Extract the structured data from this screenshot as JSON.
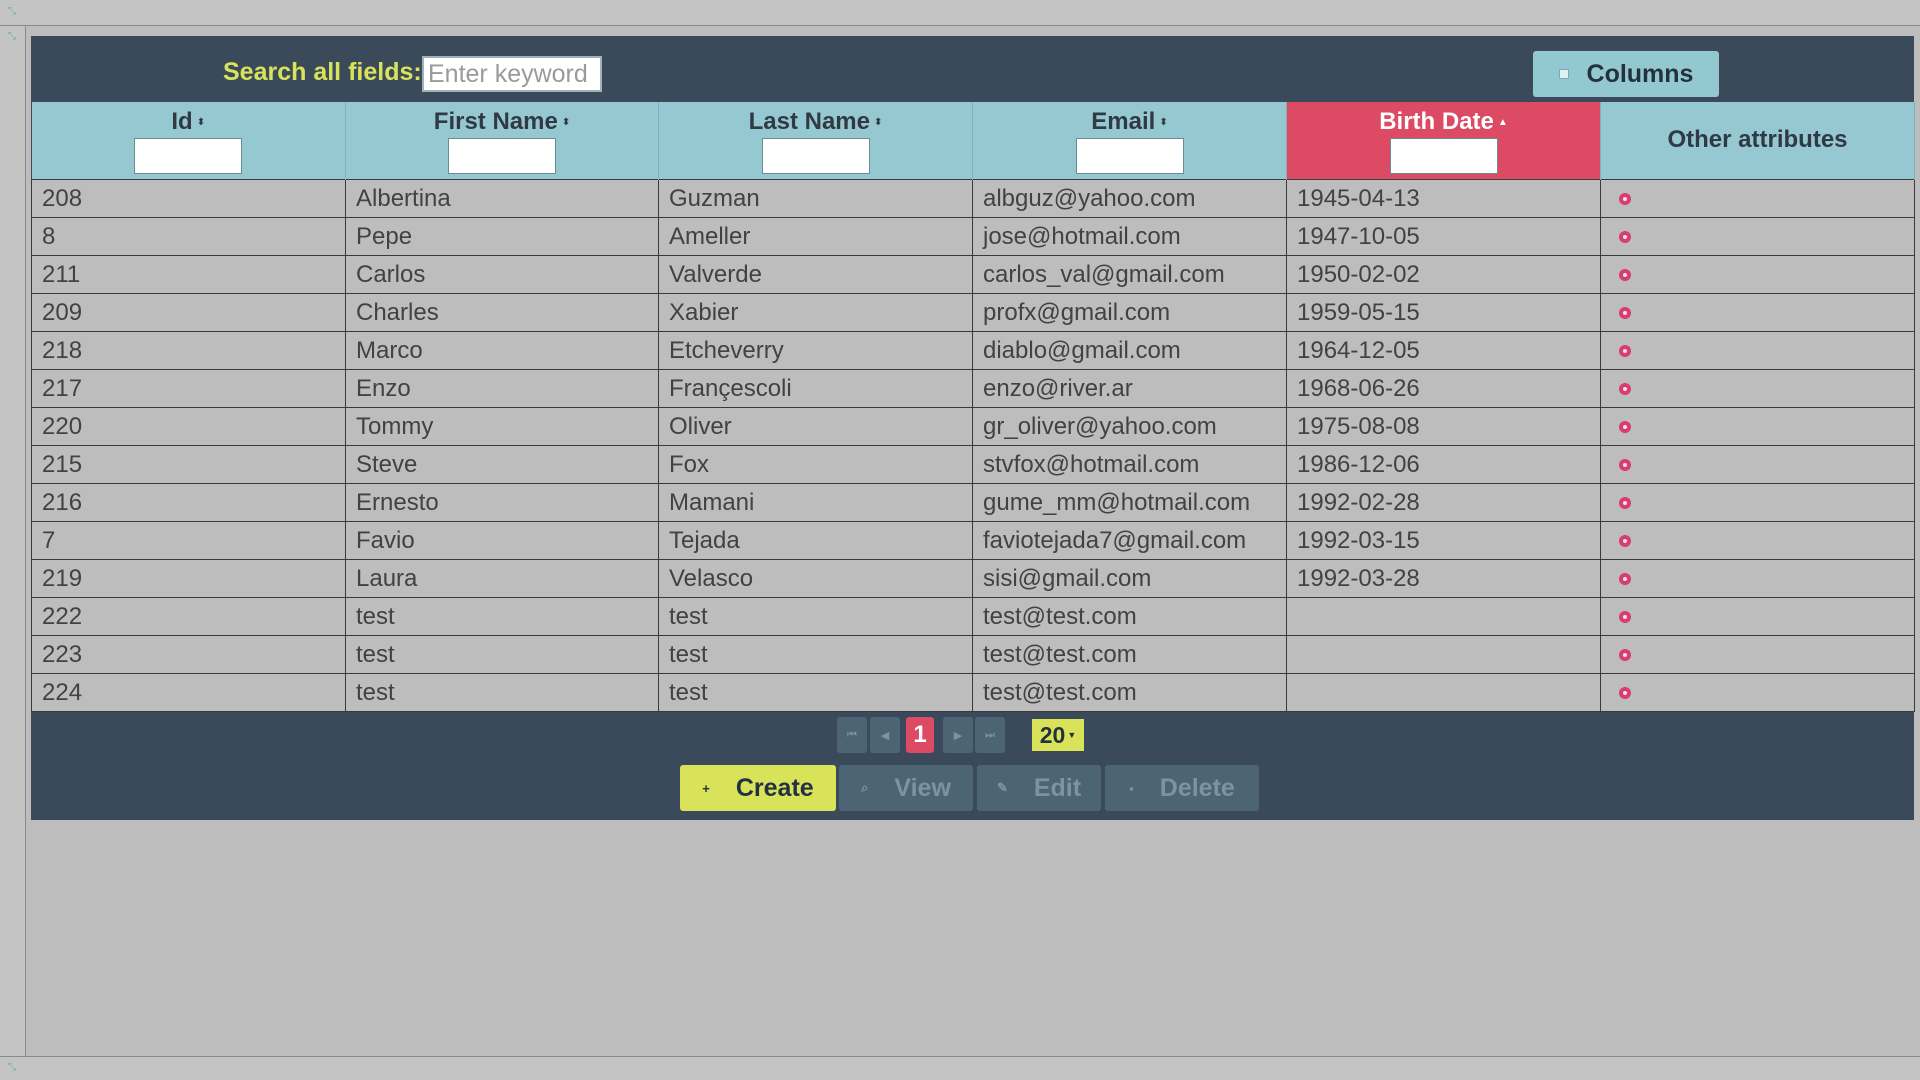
{
  "toolbar": {
    "search_label": "Search all fields:",
    "search_placeholder": "Enter keyword",
    "columns_label": "Columns"
  },
  "table": {
    "headers": [
      {
        "label": "Id",
        "sortable": true,
        "sorted": false
      },
      {
        "label": "First Name",
        "sortable": true,
        "sorted": false
      },
      {
        "label": "Last Name",
        "sortable": true,
        "sorted": false
      },
      {
        "label": "Email",
        "sortable": true,
        "sorted": false
      },
      {
        "label": "Birth Date",
        "sortable": true,
        "sorted": true
      },
      {
        "label": "Other attributes",
        "sortable": false,
        "sorted": false
      }
    ],
    "rows": [
      [
        "208",
        "Albertina",
        "Guzman",
        "albguz@yahoo.com",
        "1945-04-13"
      ],
      [
        "8",
        "Pepe",
        "Ameller",
        "jose@hotmail.com",
        "1947-10-05"
      ],
      [
        "211",
        "Carlos",
        "Valverde",
        "carlos_val@gmail.com",
        "1950-02-02"
      ],
      [
        "209",
        "Charles",
        "Xabier",
        "profx@gmail.com",
        "1959-05-15"
      ],
      [
        "218",
        "Marco",
        "Etcheverry",
        "diablo@gmail.com",
        "1964-12-05"
      ],
      [
        "217",
        "Enzo",
        "Françescoli",
        "enzo@river.ar",
        "1968-06-26"
      ],
      [
        "220",
        "Tommy",
        "Oliver",
        "gr_oliver@yahoo.com",
        "1975-08-08"
      ],
      [
        "215",
        "Steve",
        "Fox",
        "stvfox@hotmail.com",
        "1986-12-06"
      ],
      [
        "216",
        "Ernesto",
        "Mamani",
        "gume_mm@hotmail.com",
        "1992-02-28"
      ],
      [
        "7",
        "Favio",
        "Tejada",
        "faviotejada7@gmail.com",
        "1992-03-15"
      ],
      [
        "219",
        "Laura",
        "Velasco",
        "sisi@gmail.com",
        "1992-03-28"
      ],
      [
        "222",
        "test",
        "test",
        "test@test.com",
        ""
      ],
      [
        "223",
        "test",
        "test",
        "test@test.com",
        ""
      ],
      [
        "224",
        "test",
        "test",
        "test@test.com",
        ""
      ]
    ]
  },
  "pager": {
    "current_page": "1",
    "page_size": "20"
  },
  "actions": {
    "create": "Create",
    "view": "View",
    "edit": "Edit",
    "delete": "Delete"
  },
  "colors": {
    "panel": "#3b4a5b",
    "header": "#96c8d1",
    "sorted_header": "#dc4a63",
    "accent_yellow": "#d9e35a",
    "row_bg": "#bdbdbd"
  }
}
